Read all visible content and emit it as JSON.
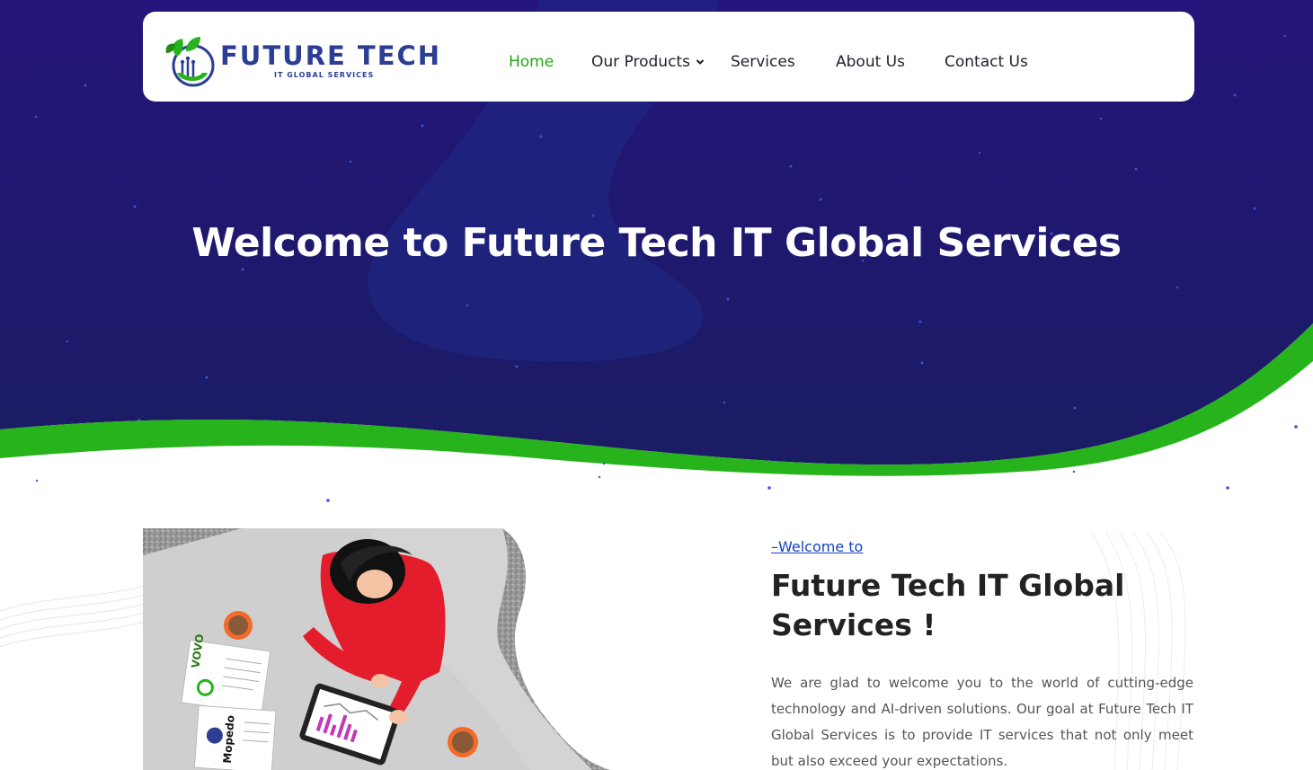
{
  "brand": {
    "name": "FUTURE TECH",
    "tagline": "IT GLOBAL SERVICES",
    "logo_icon": "leaf-circuit-icon",
    "primary_color": "#2c3e94",
    "accent_color": "#1fa812"
  },
  "nav": {
    "items": [
      {
        "label": "Home",
        "active": true
      },
      {
        "label": "Our Products",
        "has_dropdown": true
      },
      {
        "label": "Services"
      },
      {
        "label": "About Us"
      },
      {
        "label": "Contact Us"
      }
    ]
  },
  "hero": {
    "title": "Welcome to Future Tech IT Global Services",
    "background_color": "#1e1e70",
    "wave_color": "#27b31b"
  },
  "about": {
    "kicker": "–Welcome to",
    "title": "Future Tech IT Global Services !",
    "text": "We are glad to welcome you to the world of cutting-edge technology and AI-driven solutions. Our goal at Future Tech IT Global Services is to provide IT services that not only meet but also exceed your expectations."
  },
  "illustration": {
    "icon": "person-working-at-desk-illustration",
    "doc_labels": [
      "VOVO",
      "Mopedo"
    ]
  }
}
